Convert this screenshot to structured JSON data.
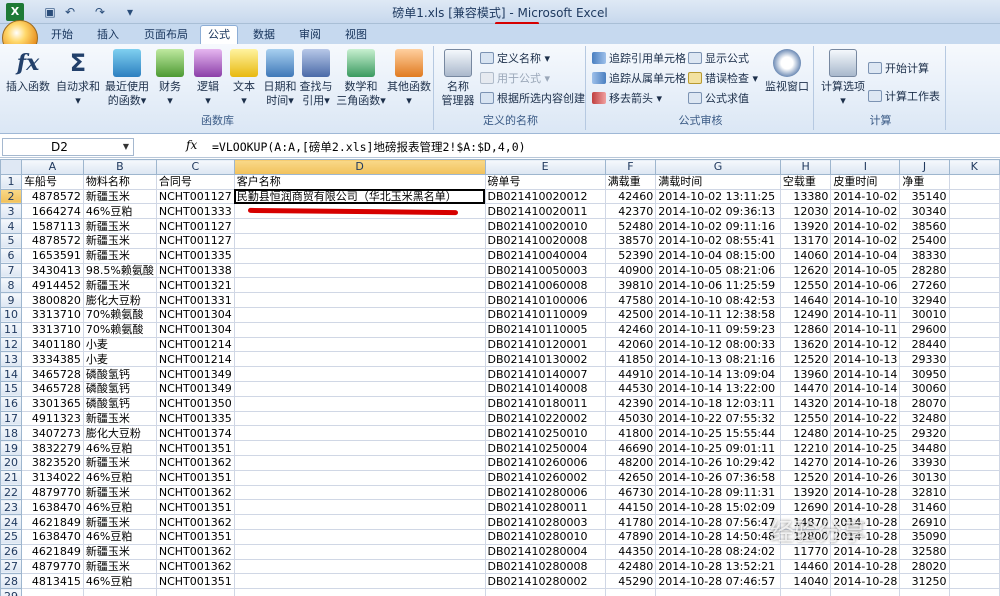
{
  "title": {
    "file": "磅单1.xls",
    "mode": " [兼容模式] - Microsoft Excel"
  },
  "tabs": [
    "开始",
    "插入",
    "页面布局",
    "公式",
    "数据",
    "审阅",
    "视图"
  ],
  "active_tab": "公式",
  "ribbon": {
    "function_library": {
      "label": "函数库",
      "insert_function": "插入函数",
      "buttons": [
        {
          "line1": "自动求和",
          "line2": "▾"
        },
        {
          "line1": "最近使用",
          "line2": "的函数▾"
        },
        {
          "line1": "财务",
          "line2": "▾"
        },
        {
          "line1": "逻辑",
          "line2": "▾"
        },
        {
          "line1": "文本",
          "line2": "▾"
        },
        {
          "line1": "日期和",
          "line2": "时间▾"
        },
        {
          "line1": "查找与",
          "line2": "引用▾"
        },
        {
          "line1": "数学和",
          "line2": "三角函数▾"
        },
        {
          "line1": "其他函数",
          "line2": "▾"
        }
      ]
    },
    "defined_names": {
      "label": "定义的名称",
      "name_manager": [
        "名称",
        "管理器"
      ],
      "define_name": "定义名称 ▾",
      "use_in_formula": "用于公式 ▾",
      "create_from_selection": "根据所选内容创建"
    },
    "formula_auditing": {
      "label": "公式审核",
      "trace_precedents": "追踪引用单元格",
      "trace_dependents": "追踪从属单元格",
      "remove_arrows": "移去箭头 ▾",
      "show_formulas": "显示公式",
      "error_checking": "错误检查 ▾",
      "evaluate_formula": "公式求值",
      "watch_window": [
        "监视窗口"
      ]
    },
    "calculation": {
      "label": "计算",
      "calc_options": [
        "计算选项",
        "▾"
      ],
      "calc_now": "开始计算",
      "calc_sheet": "计算工作表"
    }
  },
  "formula_bar": {
    "name_box": "D2",
    "fx": "fx",
    "formula": "=VLOOKUP(A:A,[磅单2.xls]地磅报表管理2!$A:$D,4,0)"
  },
  "columns": [
    "A",
    "B",
    "C",
    "D",
    "E",
    "F",
    "G",
    "H",
    "I",
    "J",
    "K"
  ],
  "rows": [
    [
      "车船号",
      "物料名称",
      "合同号",
      "客户名称",
      "磅单号",
      "满载重",
      "满载时间",
      "空载重",
      "皮重时间",
      "净重",
      ""
    ],
    [
      "4878572",
      "新疆玉米",
      "NCHT001127",
      "民勤县恒润商贸有限公司（华北玉米黑名单）",
      "DB021410020012",
      "42460",
      "2014-10-02 13:11:25",
      "13380",
      "2014-10-02",
      "35140",
      ""
    ],
    [
      "1664274",
      "46%豆粕",
      "NCHT001333",
      "",
      "DB021410020011",
      "42370",
      "2014-10-02 09:36:13",
      "12030",
      "2014-10-02",
      "30340",
      ""
    ],
    [
      "1587113",
      "新疆玉米",
      "NCHT001127",
      "",
      "DB021410020010",
      "52480",
      "2014-10-02 09:11:16",
      "13920",
      "2014-10-02",
      "38560",
      ""
    ],
    [
      "4878572",
      "新疆玉米",
      "NCHT001127",
      "",
      "DB021410020008",
      "38570",
      "2014-10-02 08:55:41",
      "13170",
      "2014-10-02",
      "25400",
      ""
    ],
    [
      "1653591",
      "新疆玉米",
      "NCHT001335",
      "",
      "DB021410040004",
      "52390",
      "2014-10-04 08:15:00",
      "14060",
      "2014-10-04",
      "38330",
      ""
    ],
    [
      "3430413",
      "98.5%赖氨酸",
      "NCHT001338",
      "",
      "DB021410050003",
      "40900",
      "2014-10-05 08:21:06",
      "12620",
      "2014-10-05",
      "28280",
      ""
    ],
    [
      "4914452",
      "新疆玉米",
      "NCHT001321",
      "",
      "DB021410060008",
      "39810",
      "2014-10-06 11:25:59",
      "12550",
      "2014-10-06",
      "27260",
      ""
    ],
    [
      "3800820",
      "膨化大豆粉",
      "NCHT001331",
      "",
      "DB021410100006",
      "47580",
      "2014-10-10 08:42:53",
      "14640",
      "2014-10-10",
      "32940",
      ""
    ],
    [
      "3313710",
      "70%赖氨酸",
      "NCHT001304",
      "",
      "DB021410110009",
      "42500",
      "2014-10-11 12:38:58",
      "12490",
      "2014-10-11",
      "30010",
      ""
    ],
    [
      "3313710",
      "70%赖氨酸",
      "NCHT001304",
      "",
      "DB021410110005",
      "42460",
      "2014-10-11 09:59:23",
      "12860",
      "2014-10-11",
      "29600",
      ""
    ],
    [
      "3401180",
      "小麦",
      "NCHT001214",
      "",
      "DB021410120001",
      "42060",
      "2014-10-12 08:00:33",
      "13620",
      "2014-10-12",
      "28440",
      ""
    ],
    [
      "3334385",
      "小麦",
      "NCHT001214",
      "",
      "DB021410130002",
      "41850",
      "2014-10-13 08:21:16",
      "12520",
      "2014-10-13",
      "29330",
      ""
    ],
    [
      "3465728",
      "磷酸氢钙",
      "NCHT001349",
      "",
      "DB021410140007",
      "44910",
      "2014-10-14 13:09:04",
      "13960",
      "2014-10-14",
      "30950",
      ""
    ],
    [
      "3465728",
      "磷酸氢钙",
      "NCHT001349",
      "",
      "DB021410140008",
      "44530",
      "2014-10-14 13:22:00",
      "14470",
      "2014-10-14",
      "30060",
      ""
    ],
    [
      "3301365",
      "磷酸氢钙",
      "NCHT001350",
      "",
      "DB021410180011",
      "42390",
      "2014-10-18 12:03:11",
      "14320",
      "2014-10-18",
      "28070",
      ""
    ],
    [
      "4911323",
      "新疆玉米",
      "NCHT001335",
      "",
      "DB021410220002",
      "45030",
      "2014-10-22 07:55:32",
      "12550",
      "2014-10-22",
      "32480",
      ""
    ],
    [
      "3407273",
      "膨化大豆粉",
      "NCHT001374",
      "",
      "DB021410250010",
      "41800",
      "2014-10-25 15:55:44",
      "12480",
      "2014-10-25",
      "29320",
      ""
    ],
    [
      "3832279",
      "46%豆粕",
      "NCHT001351",
      "",
      "DB021410250004",
      "46690",
      "2014-10-25 09:01:11",
      "12210",
      "2014-10-25",
      "34480",
      ""
    ],
    [
      "3823520",
      "新疆玉米",
      "NCHT001362",
      "",
      "DB021410260006",
      "48200",
      "2014-10-26 10:29:42",
      "14270",
      "2014-10-26",
      "33930",
      ""
    ],
    [
      "3134022",
      "46%豆粕",
      "NCHT001351",
      "",
      "DB021410260002",
      "42650",
      "2014-10-26 07:36:58",
      "12520",
      "2014-10-26",
      "30130",
      ""
    ],
    [
      "4879770",
      "新疆玉米",
      "NCHT001362",
      "",
      "DB021410280006",
      "46730",
      "2014-10-28 09:11:31",
      "13920",
      "2014-10-28",
      "32810",
      ""
    ],
    [
      "1638470",
      "46%豆粕",
      "NCHT001351",
      "",
      "DB021410280011",
      "44150",
      "2014-10-28 15:02:09",
      "12690",
      "2014-10-28",
      "31460",
      ""
    ],
    [
      "4621849",
      "新疆玉米",
      "NCHT001362",
      "",
      "DB021410280003",
      "41780",
      "2014-10-28 07:56:47",
      "14870",
      "2014-10-28",
      "26910",
      ""
    ],
    [
      "1638470",
      "46%豆粕",
      "NCHT001351",
      "",
      "DB021410280010",
      "47890",
      "2014-10-28 14:50:48",
      "12800",
      "2014-10-28",
      "35090",
      ""
    ],
    [
      "4621849",
      "新疆玉米",
      "NCHT001362",
      "",
      "DB021410280004",
      "44350",
      "2014-10-28 08:24:02",
      "11770",
      "2014-10-28",
      "32580",
      ""
    ],
    [
      "4879770",
      "新疆玉米",
      "NCHT001362",
      "",
      "DB021410280008",
      "42480",
      "2014-10-28 13:52:21",
      "14460",
      "2014-10-28",
      "28020",
      ""
    ],
    [
      "4813415",
      "46%豆粕",
      "NCHT001351",
      "",
      "DB021410280002",
      "45290",
      "2014-10-28 07:46:57",
      "14040",
      "2014-10-28",
      "31250",
      ""
    ],
    [
      "",
      "",
      "",
      "",
      "",
      "",
      "",
      "",
      "",
      "",
      ""
    ]
  ],
  "watermark": "经验分享"
}
